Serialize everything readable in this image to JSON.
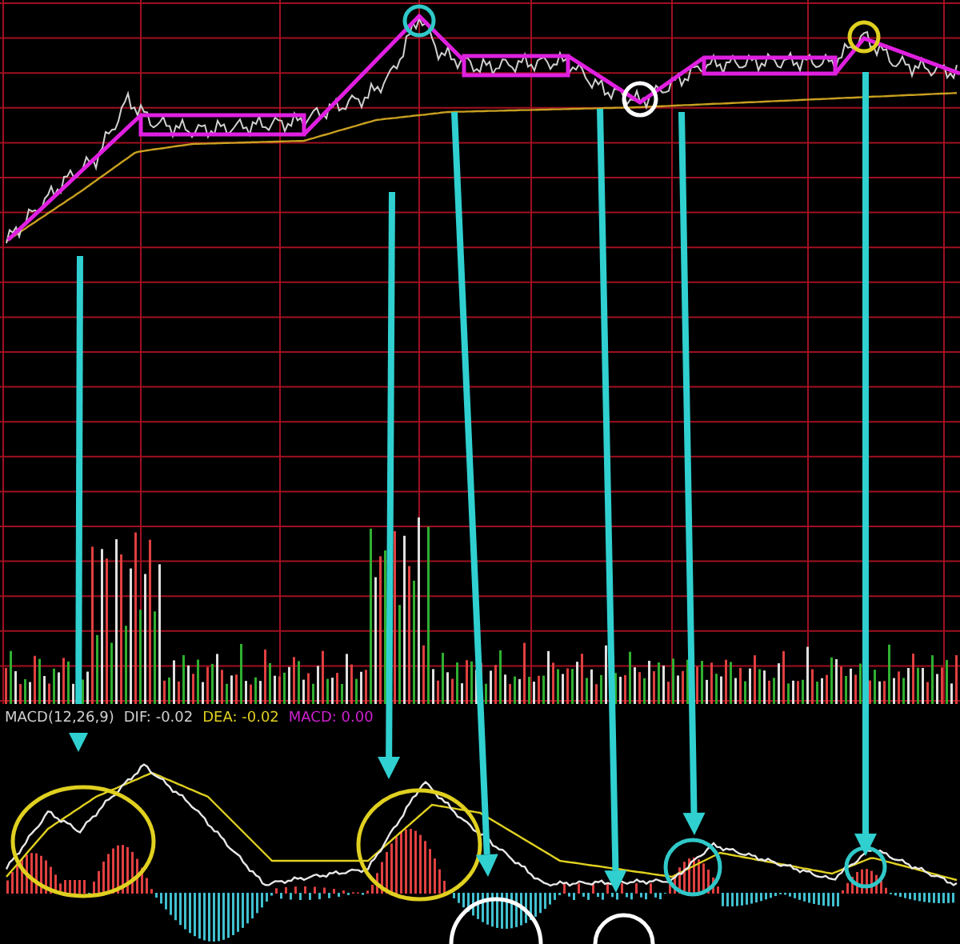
{
  "macd_legend": [
    {
      "kind": "name",
      "text": "MACD(12,26,9)"
    },
    {
      "kind": "dif",
      "text": "DIF: -0.02"
    },
    {
      "kind": "dea",
      "text": "DEA: -0.02"
    },
    {
      "kind": "macd",
      "text": "MACD: 0.00"
    }
  ]
}
